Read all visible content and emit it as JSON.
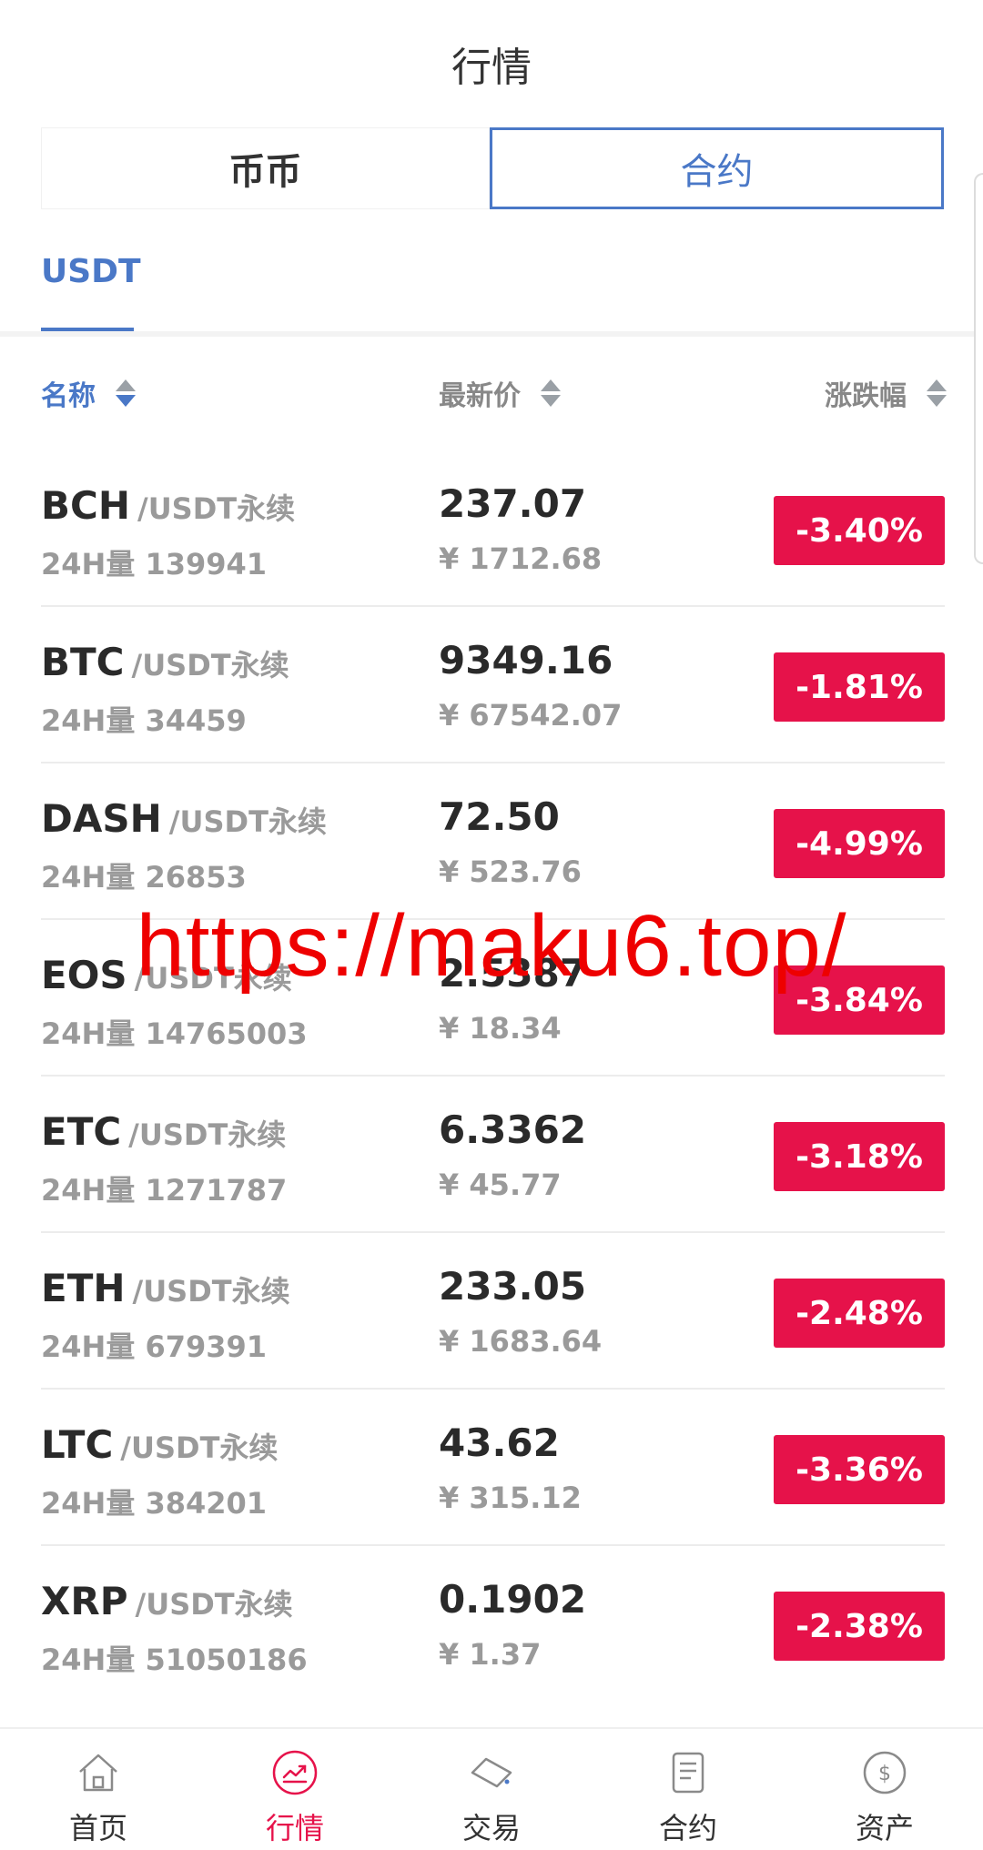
{
  "header": {
    "title": "行情"
  },
  "segment": {
    "left_label": "币币",
    "right_label": "合约"
  },
  "subtabs": {
    "active": "USDT"
  },
  "columns": {
    "name": "名称",
    "price": "最新价",
    "change": "涨跌幅"
  },
  "rows": [
    {
      "symbol": "BCH",
      "pair": "/USDT永续",
      "volume": "24H量 139941",
      "price": "237.07",
      "cny": "¥ 1712.68",
      "change": "-3.40%"
    },
    {
      "symbol": "BTC",
      "pair": "/USDT永续",
      "volume": "24H量 34459",
      "price": "9349.16",
      "cny": "¥ 67542.07",
      "change": "-1.81%"
    },
    {
      "symbol": "DASH",
      "pair": "/USDT永续",
      "volume": "24H量 26853",
      "price": "72.50",
      "cny": "¥ 523.76",
      "change": "-4.99%"
    },
    {
      "symbol": "EOS",
      "pair": "/USDT永续",
      "volume": "24H量 14765003",
      "price": "2.5387",
      "cny": "¥ 18.34",
      "change": "-3.84%"
    },
    {
      "symbol": "ETC",
      "pair": "/USDT永续",
      "volume": "24H量 1271787",
      "price": "6.3362",
      "cny": "¥ 45.77",
      "change": "-3.18%"
    },
    {
      "symbol": "ETH",
      "pair": "/USDT永续",
      "volume": "24H量 679391",
      "price": "233.05",
      "cny": "¥ 1683.64",
      "change": "-2.48%"
    },
    {
      "symbol": "LTC",
      "pair": "/USDT永续",
      "volume": "24H量 384201",
      "price": "43.62",
      "cny": "¥ 315.12",
      "change": "-3.36%"
    },
    {
      "symbol": "XRP",
      "pair": "/USDT永续",
      "volume": "24H量 51050186",
      "price": "0.1902",
      "cny": "¥ 1.37",
      "change": "-2.38%"
    }
  ],
  "watermark": "https://maku6.top/",
  "nav": [
    {
      "label": "首页",
      "icon": "home-icon",
      "active": false
    },
    {
      "label": "行情",
      "icon": "market-chart-icon",
      "active": true
    },
    {
      "label": "交易",
      "icon": "trade-icon",
      "active": false
    },
    {
      "label": "合约",
      "icon": "contract-icon",
      "active": false
    },
    {
      "label": "资产",
      "icon": "assets-icon",
      "active": false
    }
  ],
  "colors": {
    "accent_blue": "#4a78c7",
    "down_red": "#e6124a",
    "active_nav": "#e6124a"
  }
}
